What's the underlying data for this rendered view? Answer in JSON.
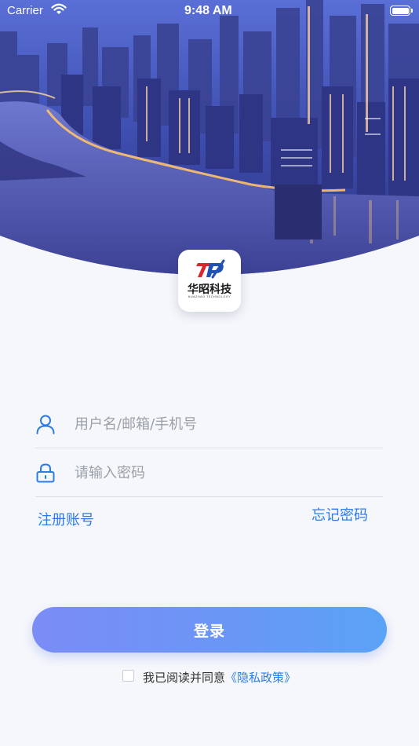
{
  "status_bar": {
    "carrier": "Carrier",
    "time": "9:48 AM"
  },
  "logo": {
    "mark": "TP",
    "name": "华昭科技",
    "sub": "HUAZHAO TECHNOLOGY"
  },
  "form": {
    "username": {
      "placeholder": "用户名/邮箱/手机号",
      "value": "",
      "icon": "user-icon"
    },
    "password": {
      "placeholder": "请输入密码",
      "value": "",
      "icon": "lock-icon"
    }
  },
  "links": {
    "register": "注册账号",
    "forgot": "忘记密码"
  },
  "login_button": "登录",
  "agreement": {
    "text": "我已阅读并同意",
    "link": "《隐私政策》",
    "checked": false
  },
  "colors": {
    "accent": "#2a7ce8",
    "button_start": "#7b8cf6",
    "button_end": "#5aa3f6",
    "background": "#f6f7fb"
  }
}
